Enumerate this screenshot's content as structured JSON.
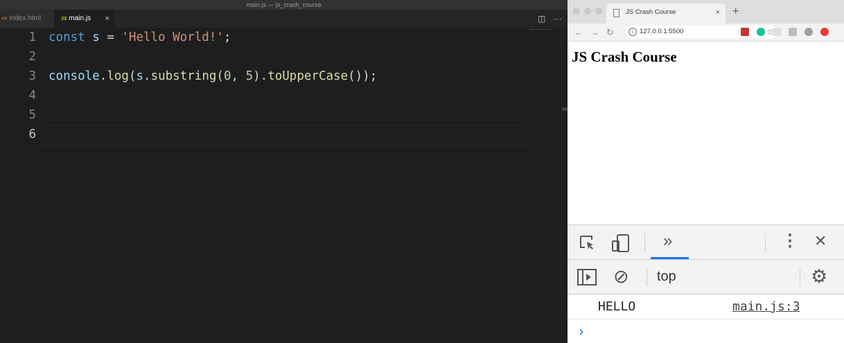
{
  "editor": {
    "window_title": "main.js — js_crash_course",
    "tabs": [
      {
        "icon": "<>",
        "label": "index.html"
      },
      {
        "icon": "JS",
        "label": "main.js",
        "close": "×"
      }
    ],
    "actions": {
      "split": "◫",
      "more": "···"
    },
    "lines": [
      {
        "n": "1",
        "tokens": [
          {
            "t": "const",
            "c": "kw"
          },
          {
            "t": " "
          },
          {
            "t": "s",
            "c": "var"
          },
          {
            "t": " = "
          },
          {
            "t": "'Hello World!'",
            "c": "str"
          },
          {
            "t": ";"
          }
        ]
      },
      {
        "n": "2",
        "tokens": []
      },
      {
        "n": "3",
        "tokens": [
          {
            "t": "console",
            "c": "var"
          },
          {
            "t": "."
          },
          {
            "t": "log",
            "c": "fn"
          },
          {
            "t": "("
          },
          {
            "t": "s",
            "c": "var"
          },
          {
            "t": "."
          },
          {
            "t": "substring",
            "c": "fn"
          },
          {
            "t": "("
          },
          {
            "t": "0",
            "c": "num"
          },
          {
            "t": ", "
          },
          {
            "t": "5",
            "c": "num"
          },
          {
            "t": ")."
          },
          {
            "t": "toUpperCase",
            "c": "fn"
          },
          {
            "t": "());"
          }
        ]
      },
      {
        "n": "4",
        "tokens": []
      },
      {
        "n": "5",
        "tokens": []
      },
      {
        "n": "6",
        "tokens": []
      }
    ]
  },
  "browser": {
    "tab_title": "JS Crash Course",
    "tab_close": "×",
    "new_tab": "+",
    "nav": {
      "back": "←",
      "forward": "→",
      "reload": "↻"
    },
    "info": "i",
    "url": "127.0.0.1:5500",
    "star": "☆",
    "extensions": [
      {
        "name": "pdf-extension-icon",
        "color": "#c0392b"
      },
      {
        "name": "grammarly-extension-icon",
        "color": "#15c39a"
      },
      {
        "name": "blank-extension-icon",
        "color": "#e0e0e0"
      },
      {
        "name": "dropper-extension-icon",
        "color": "#bdbdbd"
      },
      {
        "name": "translate-extension-icon",
        "color": "#9e9e9e"
      },
      {
        "name": "stop-extension-icon",
        "color": "#e53935"
      }
    ],
    "page_heading": "JS Crash Course"
  },
  "devtools": {
    "more_tabs": "»",
    "kebab": "⋮",
    "close": "✕",
    "context": "top",
    "block": "⊘",
    "gear": "⚙",
    "log_message": "HELLO",
    "log_source": "main.js:3",
    "prompt": "›",
    "accent": "#1a73e8"
  }
}
